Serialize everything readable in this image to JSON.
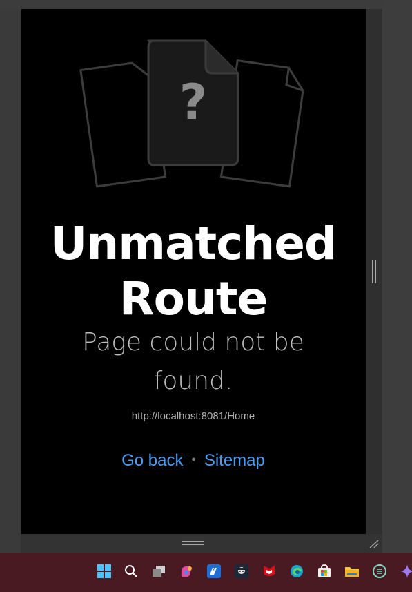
{
  "page": {
    "title": "Unmatched Route",
    "subtitle": "Page could not be found.",
    "url": "http://localhost:8081/Home",
    "icon_glyph": "?"
  },
  "nav_links": {
    "back_label": "Go back",
    "separator": "•",
    "sitemap_label": "Sitemap"
  },
  "taskbar": {
    "icons": [
      "windows-start-icon",
      "search-icon",
      "task-view-icon",
      "copilot-icon",
      "app-icon",
      "pirate-icon",
      "mcafee-icon",
      "edge-icon",
      "store-icon",
      "file-explorer-icon",
      "chatgpt-icon",
      "gemini-icon"
    ]
  },
  "colors": {
    "background": "#000000",
    "title": "#ffffff",
    "subtitle": "#bfbfbf",
    "link": "#4a9df5",
    "taskbar": "#4a1a22"
  }
}
